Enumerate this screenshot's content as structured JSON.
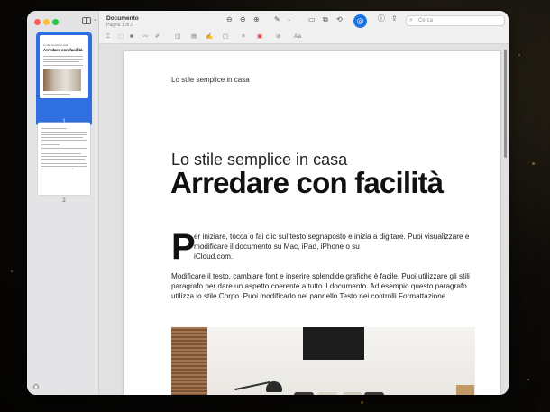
{
  "window": {
    "title": "Documento",
    "subtitle": "Pagina 1 di 2"
  },
  "sidebar": {
    "thumbnails": [
      {
        "page_label": "1",
        "selected": true,
        "mini_subtitle": "Lo stile semplice in casa",
        "mini_title": "Arredare con facilità"
      },
      {
        "page_label": "2",
        "selected": false
      }
    ]
  },
  "toolbar": {
    "search_placeholder": "Cerca",
    "markup_row_extra": "Aa",
    "icons": [
      "sidebar-icon",
      "zoom-out-icon",
      "zoom-in-icon",
      "zoom-fit-icon",
      "pen-icon",
      "textbox-icon",
      "share-box-icon",
      "rotate-icon",
      "highlight-icon",
      "markup-icon",
      "info-icon",
      "share-icon",
      "search-icon"
    ]
  },
  "document": {
    "header_text": "Lo stile semplice in casa",
    "subtitle": "Lo stile semplice in casa",
    "headline": "Arredare con facilità",
    "drop_cap": "P",
    "paragraph1_first": "er iniziare, tocca o fai clic sul testo segnaposto e inizia a digitare. Puoi visualizzare e modificare il documento su Mac, iPad, iPhone o su",
    "paragraph1_last": "iCloud.com.",
    "paragraph2": "Modificare il testo, cambiare font e inserire splendide grafiche è facile. Puoi utilizzare gli stili paragrafo per dare un aspetto coerente a tutto il documento. Ad esempio questo paragrafo utilizza lo stile Corpo. Puoi modificarlo nel pannello Testo nei controlli Formattazione."
  },
  "colors": {
    "accent": "#1a73e8",
    "selection": "#2f6fe0"
  }
}
